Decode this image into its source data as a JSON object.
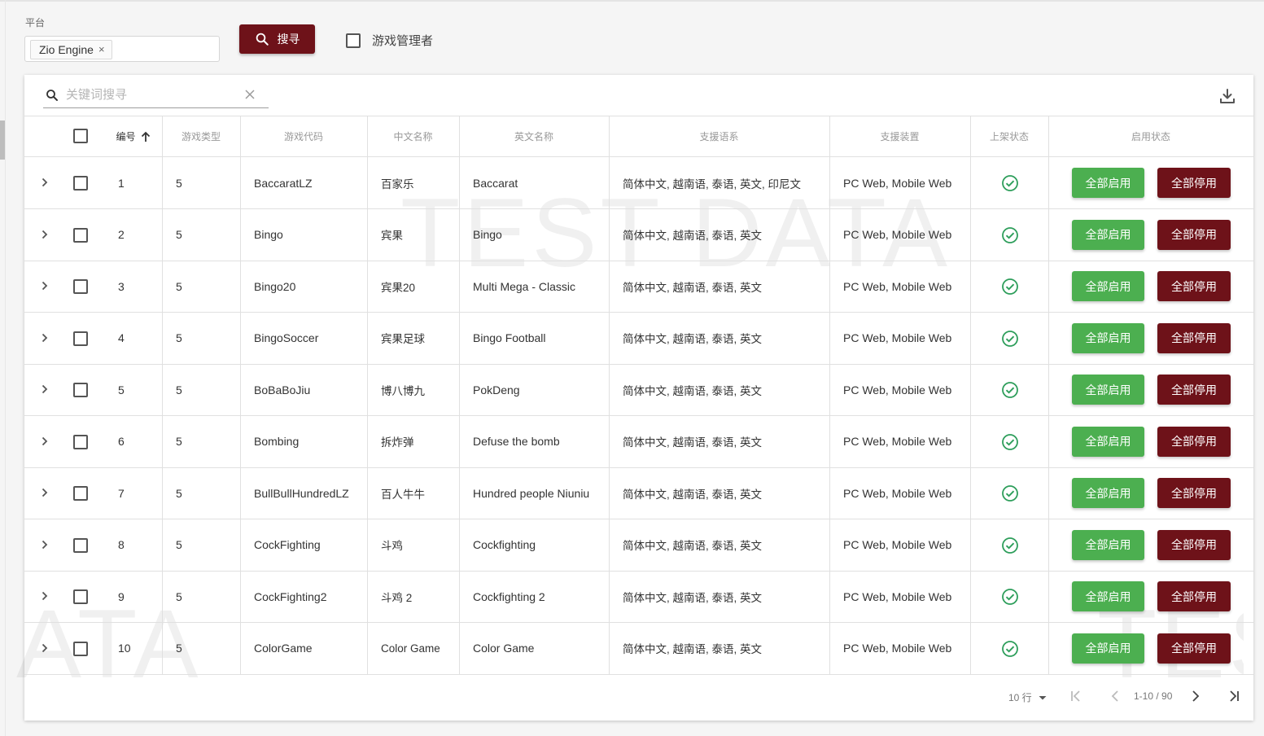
{
  "filter": {
    "platform_label": "平台",
    "platform_chip": "Zio Engine",
    "chip_remove": "×",
    "search_button": "搜寻",
    "game_manager_label": "游戏管理者"
  },
  "table": {
    "keyword_placeholder": "关键词搜寻",
    "headers": {
      "id": "编号",
      "type": "游戏类型",
      "code": "游戏代码",
      "zh_name": "中文名称",
      "en_name": "英文名称",
      "languages": "支援语系",
      "devices": "支援装置",
      "listed": "上架状态",
      "enabled": "启用状态"
    },
    "enable_all_label": "全部启用",
    "disable_all_label": "全部停用",
    "rows": [
      {
        "id": "1",
        "type": "5",
        "code": "BaccaratLZ",
        "zh": "百家乐",
        "en": "Baccarat",
        "langs": "简体中文, 越南语, 泰语, 英文, 印尼文",
        "devices": "PC Web, Mobile Web"
      },
      {
        "id": "2",
        "type": "5",
        "code": "Bingo",
        "zh": "宾果",
        "en": "Bingo",
        "langs": "简体中文, 越南语, 泰语, 英文",
        "devices": "PC Web, Mobile Web"
      },
      {
        "id": "3",
        "type": "5",
        "code": "Bingo20",
        "zh": "宾果20",
        "en": "Multi Mega - Classic",
        "langs": "简体中文, 越南语, 泰语, 英文",
        "devices": "PC Web, Mobile Web"
      },
      {
        "id": "4",
        "type": "5",
        "code": "BingoSoccer",
        "zh": "宾果足球",
        "en": "Bingo Football",
        "langs": "简体中文, 越南语, 泰语, 英文",
        "devices": "PC Web, Mobile Web"
      },
      {
        "id": "5",
        "type": "5",
        "code": "BoBaBoJiu",
        "zh": "博八博九",
        "en": "PokDeng",
        "langs": "简体中文, 越南语, 泰语, 英文",
        "devices": "PC Web, Mobile Web"
      },
      {
        "id": "6",
        "type": "5",
        "code": "Bombing",
        "zh": "拆炸弹",
        "en": "Defuse the bomb",
        "langs": "简体中文, 越南语, 泰语, 英文",
        "devices": "PC Web, Mobile Web"
      },
      {
        "id": "7",
        "type": "5",
        "code": "BullBullHundredLZ",
        "zh": "百人牛牛",
        "en": "Hundred people Niuniu",
        "langs": "简体中文, 越南语, 泰语, 英文",
        "devices": "PC Web, Mobile Web"
      },
      {
        "id": "8",
        "type": "5",
        "code": "CockFighting",
        "zh": "斗鸡",
        "en": "Cockfighting",
        "langs": "简体中文, 越南语, 泰语, 英文",
        "devices": "PC Web, Mobile Web"
      },
      {
        "id": "9",
        "type": "5",
        "code": "CockFighting2",
        "zh": "斗鸡 2",
        "en": "Cockfighting 2",
        "langs": "简体中文, 越南语, 泰语, 英文",
        "devices": "PC Web, Mobile Web"
      },
      {
        "id": "10",
        "type": "5",
        "code": "ColorGame",
        "zh": "Color Game",
        "en": "Color Game",
        "langs": "简体中文, 越南语, 泰语, 英文",
        "devices": "PC Web, Mobile Web"
      }
    ]
  },
  "pagination": {
    "rows_per_page": "10 行",
    "range": "1-10 / 90"
  },
  "watermark": {
    "main": "TEST DATA",
    "left": "ATA",
    "right": "TES"
  },
  "colors": {
    "brand": "#6e1219",
    "enable": "#4caf50",
    "status_ok": "#2e9e5b"
  }
}
